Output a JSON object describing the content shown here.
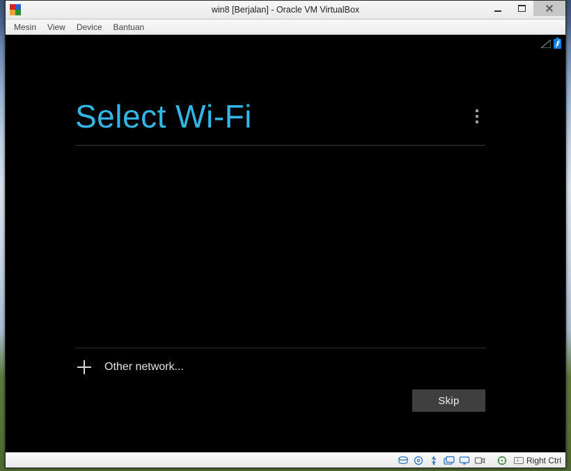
{
  "window": {
    "title": "win8 [Berjalan] - Oracle VM VirtualBox"
  },
  "menubar": {
    "machine": "Mesin",
    "view": "View",
    "device": "Device",
    "help": "Bantuan"
  },
  "guest": {
    "title": "Select Wi-Fi",
    "other_network": "Other network...",
    "skip_label": "Skip"
  },
  "statusbar": {
    "hostkey": "Right Ctrl"
  }
}
